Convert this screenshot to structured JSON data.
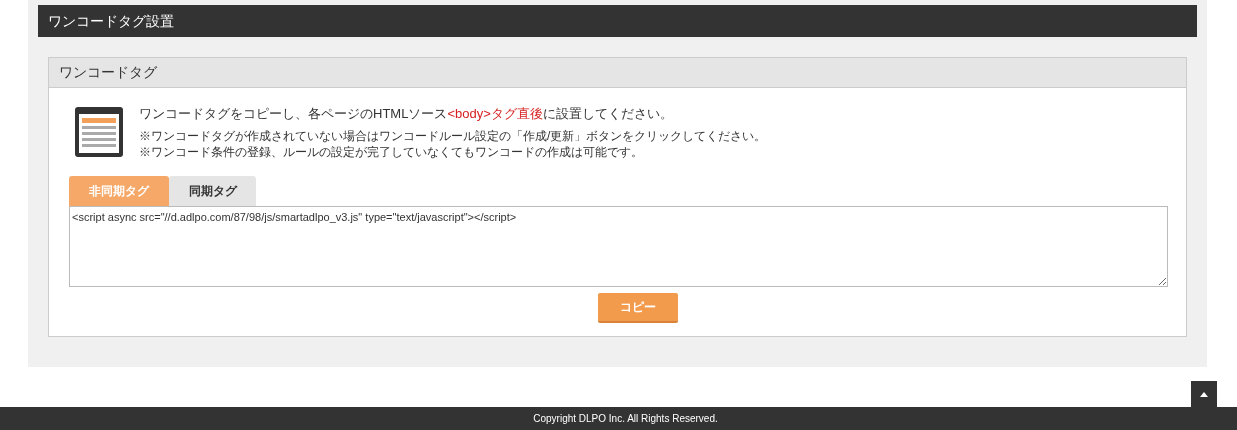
{
  "page_title": "ワンコードタグ設置",
  "panel": {
    "title": "ワンコードタグ",
    "instruction": [
      {
        "text": "ワンコードタグをコピーし、各ページのHTMLソース",
        "highlight": false
      },
      {
        "text": "<body>タグ直後",
        "highlight": true
      },
      {
        "text": "に設置してください。",
        "highlight": false
      }
    ],
    "notes": [
      "※ワンコードタグが作成されていない場合はワンコードルール設定の「作成/更新」ボタンをクリックしてください。",
      "※ワンコード条件の登録、ルールの設定が完了していなくてもワンコードの作成は可能です。"
    ],
    "tabs": [
      {
        "label": "非同期タグ",
        "selected": true
      },
      {
        "label": "同期タグ",
        "selected": false
      }
    ],
    "code": "<script async src=\"//d.adlpo.com/87/98/js/smartadlpo_v3.js\" type=\"text/javascript\"></script>",
    "copy_button": "コピー"
  },
  "footer": "Copyright DLPO Inc. All Rights Reserved."
}
